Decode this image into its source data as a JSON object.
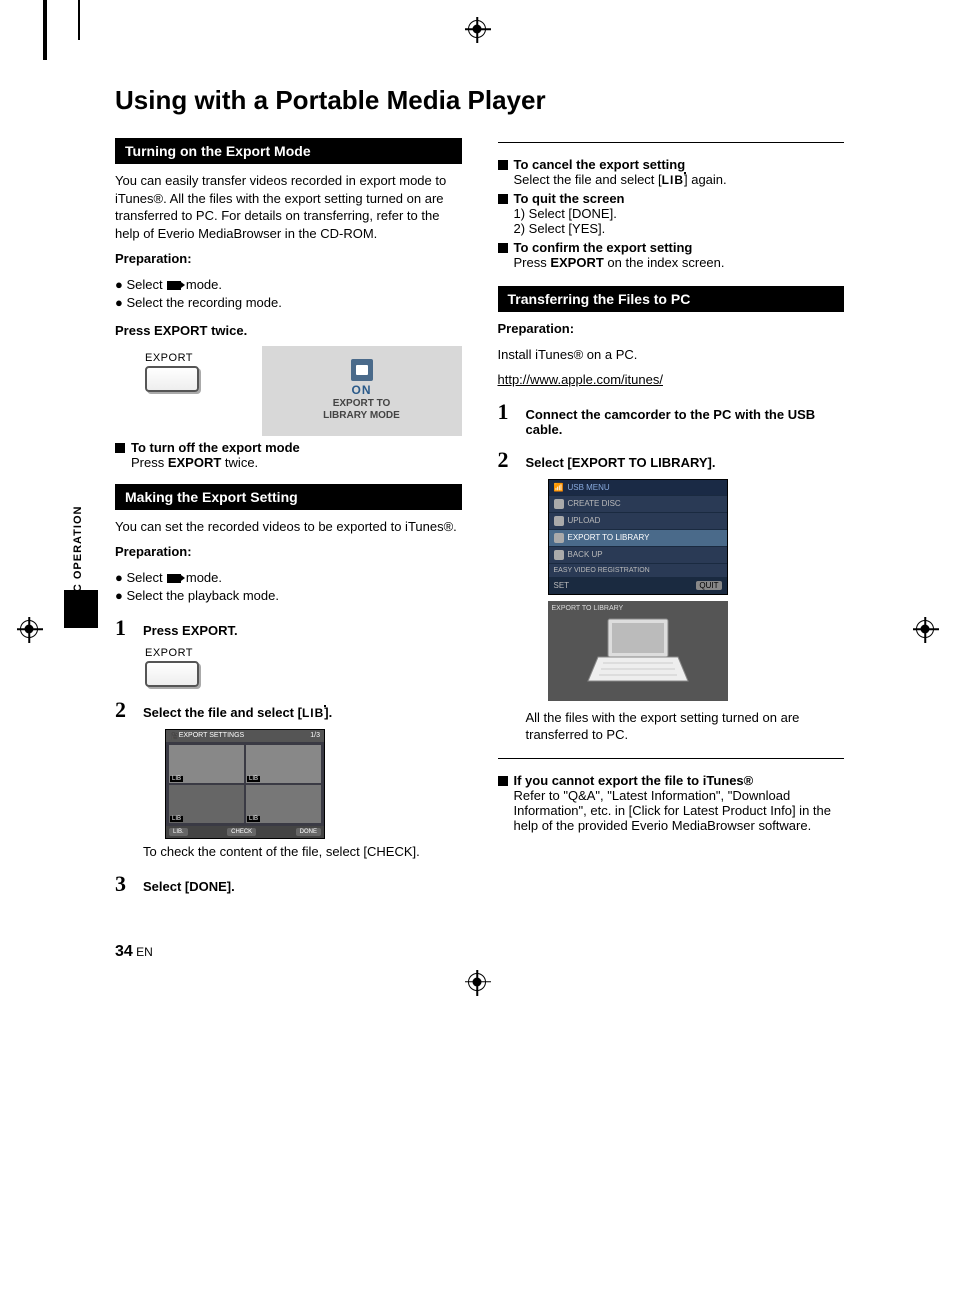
{
  "page_title": "Using with a Portable Media Player",
  "tab_label": "PC OPERATION",
  "page_number": "34",
  "page_lang": "EN",
  "left": {
    "sec1_title": "Turning on the Export Mode",
    "sec1_body": "You can easily transfer videos recorded in export mode to iTunes®. All the files with the export setting turned on are transferred to PC. For details on transferring, refer to the help of Everio MediaBrowser in the CD-ROM.",
    "prep": "Preparation:",
    "prep1a": "Select",
    "prep1b": "mode.",
    "prep2": "Select the recording mode.",
    "instr1": "Press EXPORT twice.",
    "export_label": "EXPORT",
    "gray_on": "ON",
    "gray_l1": "EXPORT TO",
    "gray_l2": "LIBRARY MODE",
    "sq1_title": "To turn off the export mode",
    "sq1_body_a": "Press ",
    "sq1_body_b": "EXPORT",
    "sq1_body_c": " twice.",
    "sec2_title": "Making the Export Setting",
    "sec2_body": "You can set the recorded videos to be exported to iTunes®.",
    "prep2b": "Select the playback mode.",
    "step1": "Press EXPORT.",
    "step2": "Select the file and select [",
    "step2_end": "].",
    "ss_hdr": "EXPORT SETTINGS",
    "ss_btn1": "LIB.",
    "ss_btn2": "CHECK",
    "ss_btn3": "DONE",
    "step2_sub": "To check the content of the file, select [CHECK].",
    "step3": "Select [DONE]."
  },
  "right": {
    "sq_cancel_t": "To cancel the export setting",
    "sq_cancel_b1": "Select the file and select [",
    "sq_cancel_b2": "] again.",
    "sq_quit_t": "To quit the screen",
    "sq_quit_1": "1) Select [DONE].",
    "sq_quit_2": "2) Select [YES].",
    "sq_conf_t": "To confirm the export setting",
    "sq_conf_b_a": "Press ",
    "sq_conf_b_b": "EXPORT",
    "sq_conf_b_c": " on the index screen.",
    "sec3_title": "Transferring the Files to PC",
    "prep": "Preparation:",
    "prep_body": "Install iTunes® on a PC.",
    "url": "http://www.apple.com/itunes/",
    "step1": "Connect the camcorder to the PC with the USB cable.",
    "step2": "Select [EXPORT TO LIBRARY].",
    "usb_hdr": "USB MENU",
    "usb_r1": "CREATE DISC",
    "usb_r2": "UPLOAD",
    "usb_r3": "EXPORT TO LIBRARY",
    "usb_r4": "BACK UP",
    "usb_r5": "EASY VIDEO REGISTRATION",
    "usb_set": "SET",
    "usb_quit": "QUIT",
    "laptop_bar": "EXPORT TO LIBRARY",
    "step2_sub": "All the files with the export setting turned on are transferred to PC.",
    "sq_fail_t": "If you cannot export the file to iTunes®",
    "sq_fail_b": "Refer to \"Q&A\", \"Latest Information\", \"Download Information\", etc. in [Click for Latest Product Info] in the help of the provided Everio MediaBrowser software."
  }
}
